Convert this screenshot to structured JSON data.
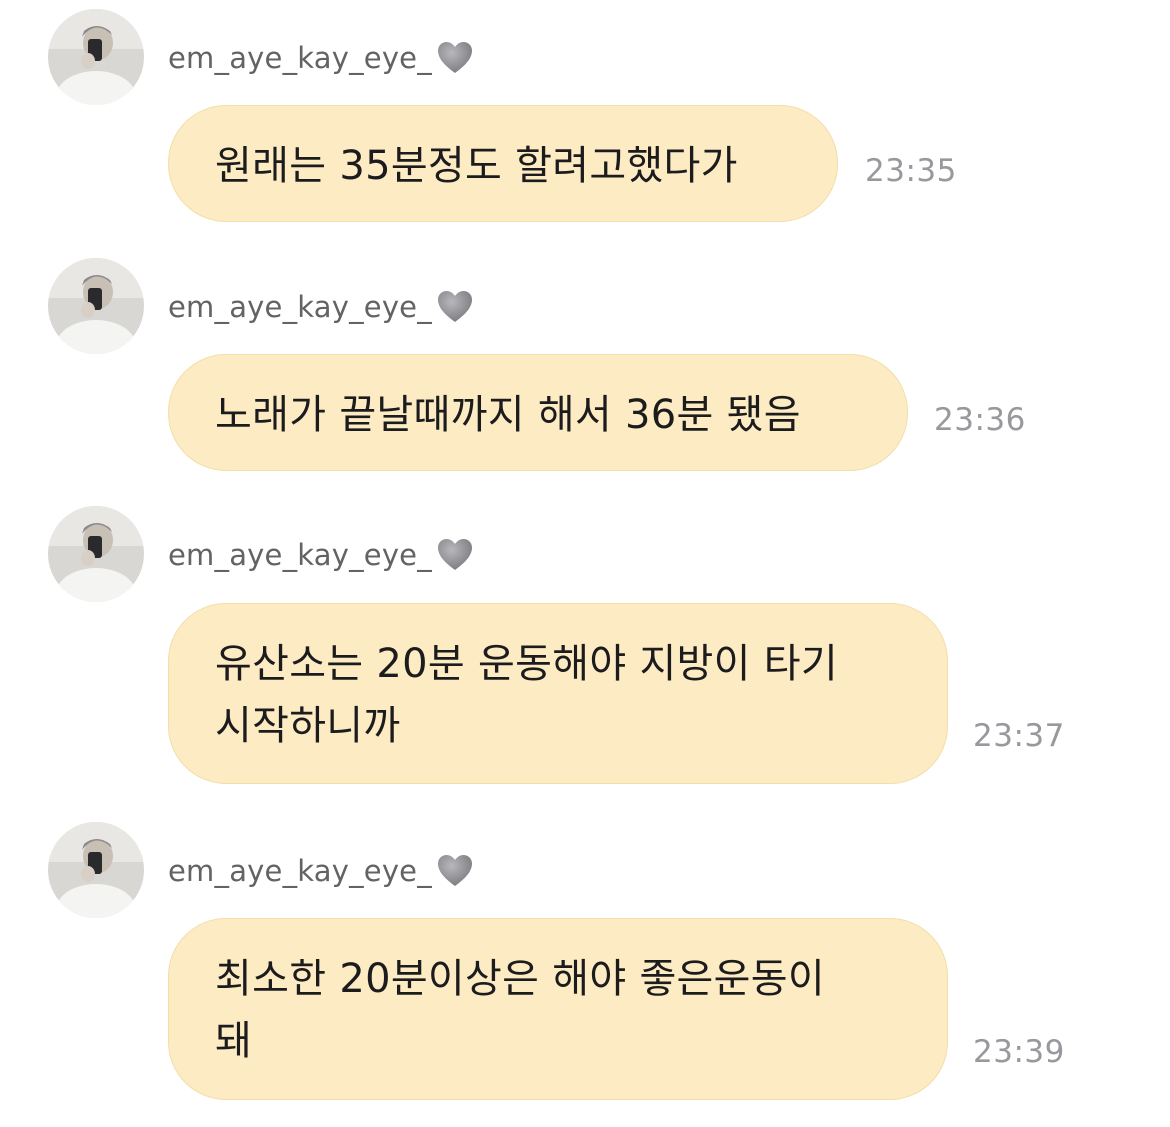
{
  "messages": [
    {
      "sender": "em_aye_kay_eye_",
      "text": "원래는 35분정도 할려고했다가",
      "time": "23:35"
    },
    {
      "sender": "em_aye_kay_eye_",
      "text": "노래가 끝날때까지 해서 36분 됐음",
      "time": "23:36"
    },
    {
      "sender": "em_aye_kay_eye_",
      "text": "유산소는 20분 운동해야 지방이 타기\n시작하니까",
      "time": "23:37"
    },
    {
      "sender": "em_aye_kay_eye_",
      "text": "최소한 20분이상은 해야 좋은운동이\n돼",
      "time": "23:39"
    }
  ],
  "colors": {
    "bubble": "#fdecc3",
    "bubble_border": "#f3ddaa",
    "text": "#1c1c1e",
    "sender": "#636366",
    "timestamp": "#98989d",
    "heart": "#8e8e93"
  },
  "icons": {
    "heart": "grey-heart-icon",
    "avatar": "user-avatar"
  }
}
